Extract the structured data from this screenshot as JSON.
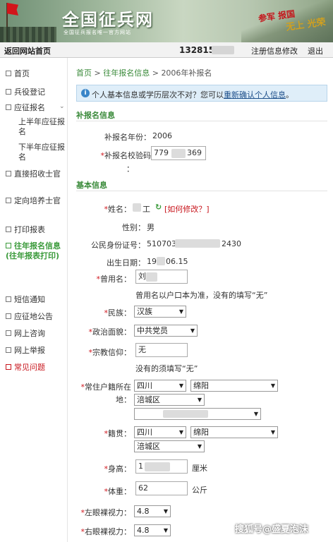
{
  "header": {
    "site_title": "全国征兵网",
    "site_subtitle": "全国征兵报名唯一官方网站",
    "slogan_1": "参军 报国",
    "slogan_2": "无上 光荣"
  },
  "topbar": {
    "home_link": "返回网站首页",
    "user_phone": "132815",
    "edit_link": "注册信息修改",
    "logout_link": "退出"
  },
  "sidebar": {
    "items": [
      {
        "label": "首页"
      },
      {
        "label": "兵役登记"
      },
      {
        "label": "应征报名"
      },
      {
        "label": "上半年应征报名"
      },
      {
        "label": "下半年应征报名"
      },
      {
        "label": "直接招收士官"
      },
      {
        "label": "定向培养士官"
      },
      {
        "label": "打印报表"
      },
      {
        "label": "往年报名信息(往年报表打印)"
      },
      {
        "label": "短信通知"
      },
      {
        "label": "应征地公告"
      },
      {
        "label": "网上咨询"
      },
      {
        "label": "网上举报"
      },
      {
        "label": "常见问题"
      }
    ]
  },
  "breadcrumb": {
    "home": "首页",
    "sep": ">",
    "past": "往年报名信息",
    "current": "2006年补报名"
  },
  "notice": {
    "text_before": "个人基本信息或学历层次不对？您可以",
    "link": "重新确认个人信息",
    "text_after": "。"
  },
  "sections": {
    "supplement": "补报名信息",
    "basic": "基本信息"
  },
  "form": {
    "year_label": "补报名年份：",
    "year_value": "2006",
    "code_label": "补报名校验码",
    "code_value": "779",
    "code_value_tail": "369",
    "code_colon": "：",
    "name_label": "姓名：",
    "name_value": "工",
    "name_change_link": "[如何修改？]",
    "gender_label": "性别：",
    "gender_value": "男",
    "id_label": "公民身份证号：",
    "id_value_head": "510703",
    "id_value_tail": "2430",
    "birth_label": "出生日期：",
    "birth_value_head": "19",
    "birth_value_tail": "06.15",
    "former_name_label": "曾用名：",
    "former_name_value": "刘",
    "former_name_hint": "曾用名以户口本为准，没有的填写“无”",
    "ethnicity_label": "民族：",
    "ethnicity_value": "汉族",
    "political_label": "政治面貌：",
    "political_value": "中共党员",
    "religion_label": "宗教信仰：",
    "religion_value": "无",
    "religion_hint": "没有的须填写“无”",
    "residence_label_1": "常住户籍所在",
    "residence_label_2": "地：",
    "residence_province": "四川",
    "residence_city": "绵阳",
    "residence_district": "涪城区",
    "native_label": "籍贯：",
    "native_province": "四川",
    "native_city": "绵阳",
    "native_district": "涪城区",
    "height_label": "身高：",
    "height_value": "1",
    "height_unit": "厘米",
    "weight_label": "体重：",
    "weight_value": "62",
    "weight_unit": "公斤",
    "left_eye_label": "左眼裸视力：",
    "left_eye_value": "4.8",
    "right_eye_label": "右眼裸视力：",
    "right_eye_value": "4.8"
  },
  "watermark": "搜狐号@盛夏泡沫",
  "colors": {
    "accent_green": "#3a8a3a",
    "required_red": "#d0161d",
    "notice_bg": "#dfeef9"
  }
}
